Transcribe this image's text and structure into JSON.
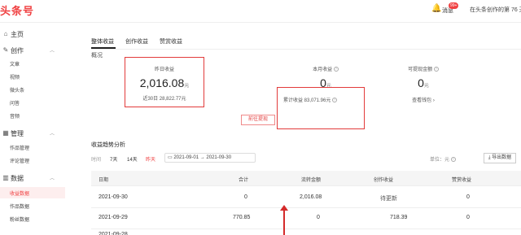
{
  "topbar": {
    "logo": "头条号",
    "notifications": "消息",
    "badge": "99+",
    "days_text": "在头条创作的第 76 天"
  },
  "sidebar": {
    "home": "主页",
    "create": "创作",
    "create_items": [
      "文章",
      "视频",
      "微头条",
      "问答",
      "音频"
    ],
    "manage": "管理",
    "manage_items": [
      "作品管理",
      "评论管理"
    ],
    "data": "数据",
    "data_items": [
      "收益数据",
      "作品数据",
      "粉丝数据"
    ],
    "icons": {
      "home": "home-icon",
      "create": "pen-icon",
      "manage": "grid-icon",
      "data": "bar-chart-icon"
    }
  },
  "tabs": [
    "整体收益",
    "创作收益",
    "赞赏收益"
  ],
  "overview": {
    "section": "概况",
    "yesterday_label": "昨日收益",
    "yesterday_value": "2,016.08",
    "yesterday_unit": "元",
    "last30": "近30日 28,822.77元",
    "month_label": "本月收益",
    "month_value": "0",
    "month_unit": "元",
    "total": "累计收益 83,071.96元",
    "withdrawable_label": "可提现金额",
    "withdrawable_value": "0",
    "withdrawable_unit": "元",
    "view_wallet": "查看钱包 ›",
    "withdraw_button": "前往提现"
  },
  "trend": {
    "title": "收益趋势分析",
    "time_label": "时间",
    "f7": "7天",
    "f14": "14天",
    "yesterday": "昨天",
    "date_from": "2021-09-01",
    "date_to": "2021-09-30",
    "unit": "单位：元",
    "export": "导出数据"
  },
  "table": {
    "headers": [
      "日期",
      "合计",
      "流转金额",
      "创作收益",
      "赞赏收益"
    ],
    "rows": [
      [
        "2021-09-30",
        "0",
        "2,016.08",
        "待更新",
        "0"
      ],
      [
        "2021-09-29",
        "770.85",
        "0",
        "718.39",
        "0"
      ],
      [
        "2021-09-28",
        "",
        "",
        "",
        ""
      ]
    ]
  }
}
